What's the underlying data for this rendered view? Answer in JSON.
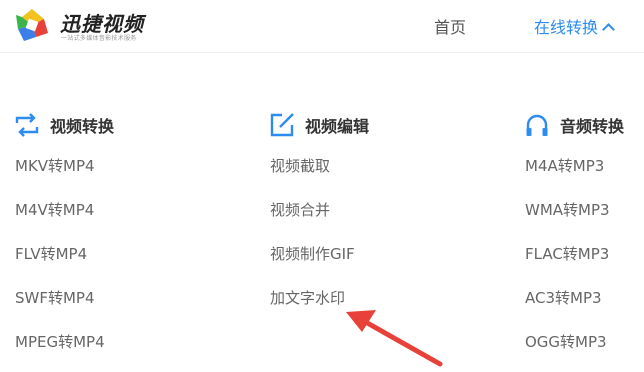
{
  "header": {
    "logo_text": "迅捷视频",
    "logo_slogan": "一站式多媒体音影技术服务",
    "nav_home": "首页",
    "nav_online_convert": "在线转换"
  },
  "columns": [
    {
      "title": "视频转换",
      "icon": "convert-arrows-icon",
      "items": [
        "MKV转MP4",
        "M4V转MP4",
        "FLV转MP4",
        "SWF转MP4",
        "MPEG转MP4"
      ]
    },
    {
      "title": "视频编辑",
      "icon": "edit-pencil-icon",
      "items": [
        "视频截取",
        "视频合并",
        "视频制作GIF",
        "加文字水印"
      ]
    },
    {
      "title": "音频转换",
      "icon": "headphones-icon",
      "items": [
        "M4A转MP3",
        "WMA转MP3",
        "FLAC转MP3",
        "AC3转MP3",
        "OGG转MP3"
      ]
    }
  ],
  "annotation": {
    "icon": "red-arrow-icon",
    "color": "#e8413a"
  },
  "colors": {
    "accent": "#2d8cf0",
    "text": "#666666",
    "title": "#333333"
  }
}
